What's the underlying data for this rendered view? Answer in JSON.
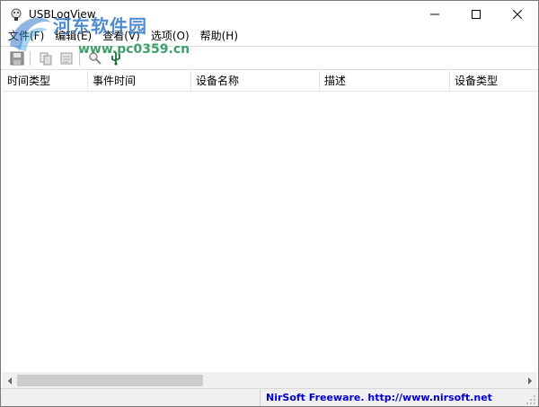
{
  "window": {
    "title": "USBLogView"
  },
  "watermark": {
    "title": "河东软件园",
    "url": "www.pc0359.cn"
  },
  "menu": {
    "items": [
      "文件(F)",
      "编辑(E)",
      "查看(V)",
      "选项(O)",
      "帮助(H)"
    ]
  },
  "toolbar": {
    "icons": [
      "save-icon",
      "copy-icon",
      "html-report-icon",
      "find-icon",
      "usb-icon"
    ]
  },
  "table": {
    "columns": [
      "时间类型",
      "事件时间",
      "设备名称",
      "描述",
      "设备类型"
    ]
  },
  "status": {
    "link": "NirSoft Freeware.  http://www.nirsoft.net"
  },
  "colors": {
    "link": "#0000cc",
    "watermark_blue": "#3478c8",
    "watermark_green": "#28965a"
  }
}
